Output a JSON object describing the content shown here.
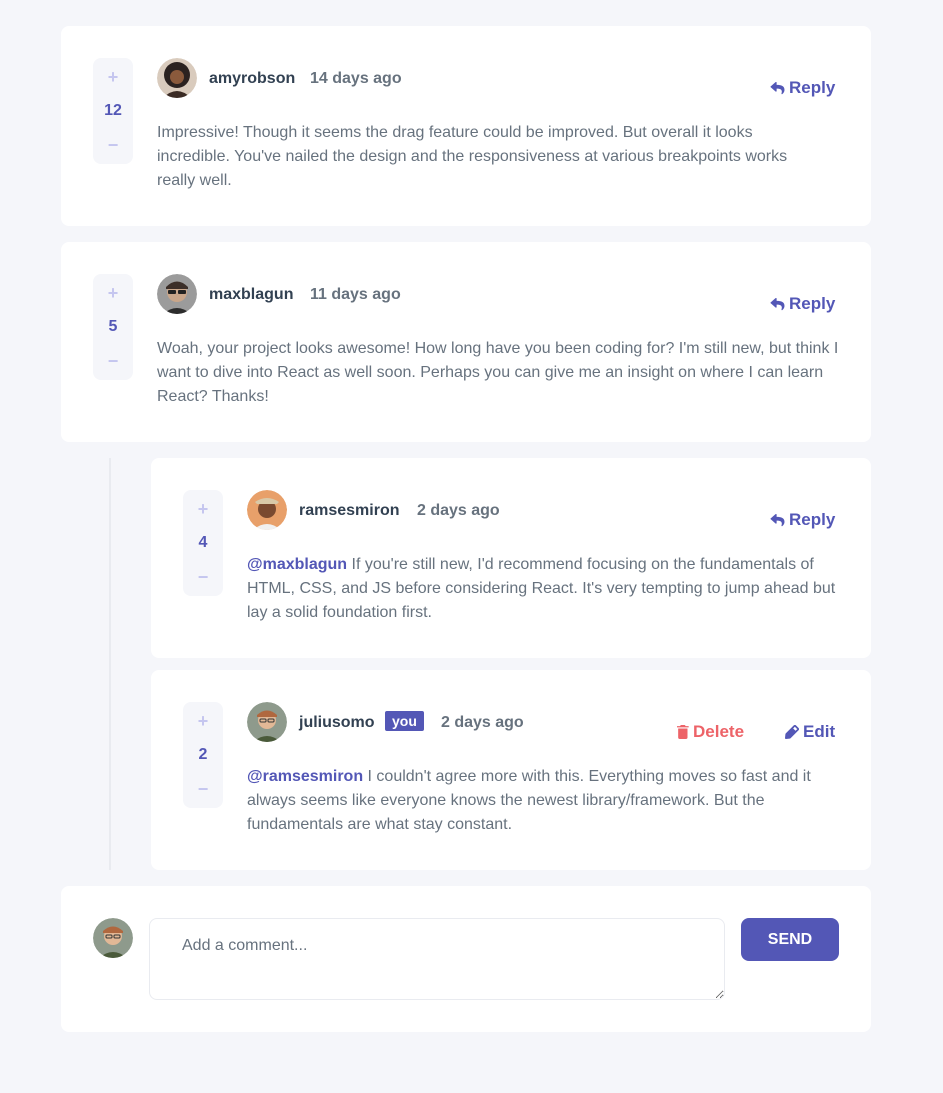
{
  "colors": {
    "background": "#f5f6fa",
    "card": "#ffffff",
    "accent": "#5357b6",
    "accent_light": "#c5c6ef",
    "danger": "#ed6368",
    "heading": "#324152",
    "text": "#67727e"
  },
  "comments": [
    {
      "score": "12",
      "username": "amyrobson",
      "time": "14 days ago",
      "reply_label": "Reply",
      "content": "Impressive! Though it seems the drag feature could be improved. But overall it looks incredible. You've nailed the design and the responsiveness at various breakpoints works really well."
    },
    {
      "score": "5",
      "username": "maxblagun",
      "time": "11 days ago",
      "reply_label": "Reply",
      "content": "Woah, your project looks awesome! How long have you been coding for? I'm still new, but think I want to dive into React as well soon. Perhaps you can give me an insight on where I can learn React? Thanks!"
    }
  ],
  "replies": [
    {
      "score": "4",
      "username": "ramsesmiron",
      "time": "2 days ago",
      "reply_label": "Reply",
      "mention": "@maxblagun",
      "content": " If you're still new, I'd recommend focusing on the fundamentals of HTML, CSS, and JS before considering React. It's very tempting to jump ahead but lay a solid foundation first."
    },
    {
      "score": "2",
      "username": "juliusomo",
      "you_badge": "you",
      "time": "2 days ago",
      "delete_label": "Delete",
      "edit_label": "Edit",
      "mention": "@ramsesmiron",
      "content": " I couldn't agree more with this. Everything moves so fast and it always seems like everyone knows the newest library/framework. But the fundamentals are what stay constant."
    }
  ],
  "vote": {
    "plus": "+",
    "minus": "−"
  },
  "new_comment": {
    "placeholder": "Add a comment...",
    "send_label": "SEND"
  },
  "icons": {
    "reply": "reply-arrow-icon",
    "delete": "trash-icon",
    "edit": "pencil-icon"
  }
}
